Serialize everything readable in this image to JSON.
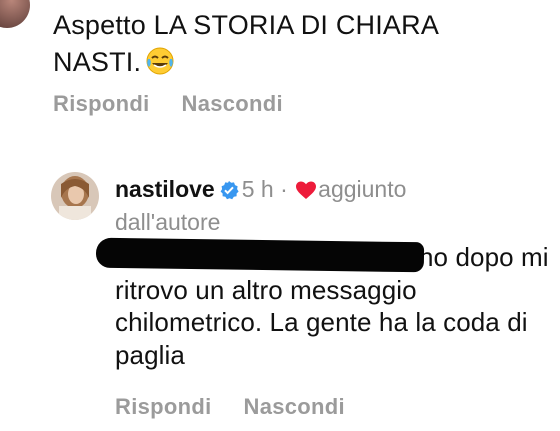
{
  "top_comment": {
    "text": "Aspetto LA STORIA DI CHIARA NASTI.",
    "emoji": "tears-of-joy-emoji",
    "reply_label": "Rispondi",
    "hide_label": "Nascondi"
  },
  "reply": {
    "username": "nastilove",
    "verified_icon": "verified-badge-icon",
    "time": "5 h",
    "separator": "·",
    "liked_by_author_1": "aggiunto",
    "liked_by_author_2": "dall'autore",
    "body_line1_visible": "no dopo",
    "body_rest": "mi ritrovo un altro messaggio chilometrico. La gente ha la coda di paglia",
    "reply_label": "Rispondi",
    "hide_label": "Nascondi"
  },
  "colors": {
    "text": "#111111",
    "muted": "#8e8e8e",
    "action": "#9b9b9b",
    "heart": "#ed1b3a",
    "verified": "#3897f0"
  }
}
